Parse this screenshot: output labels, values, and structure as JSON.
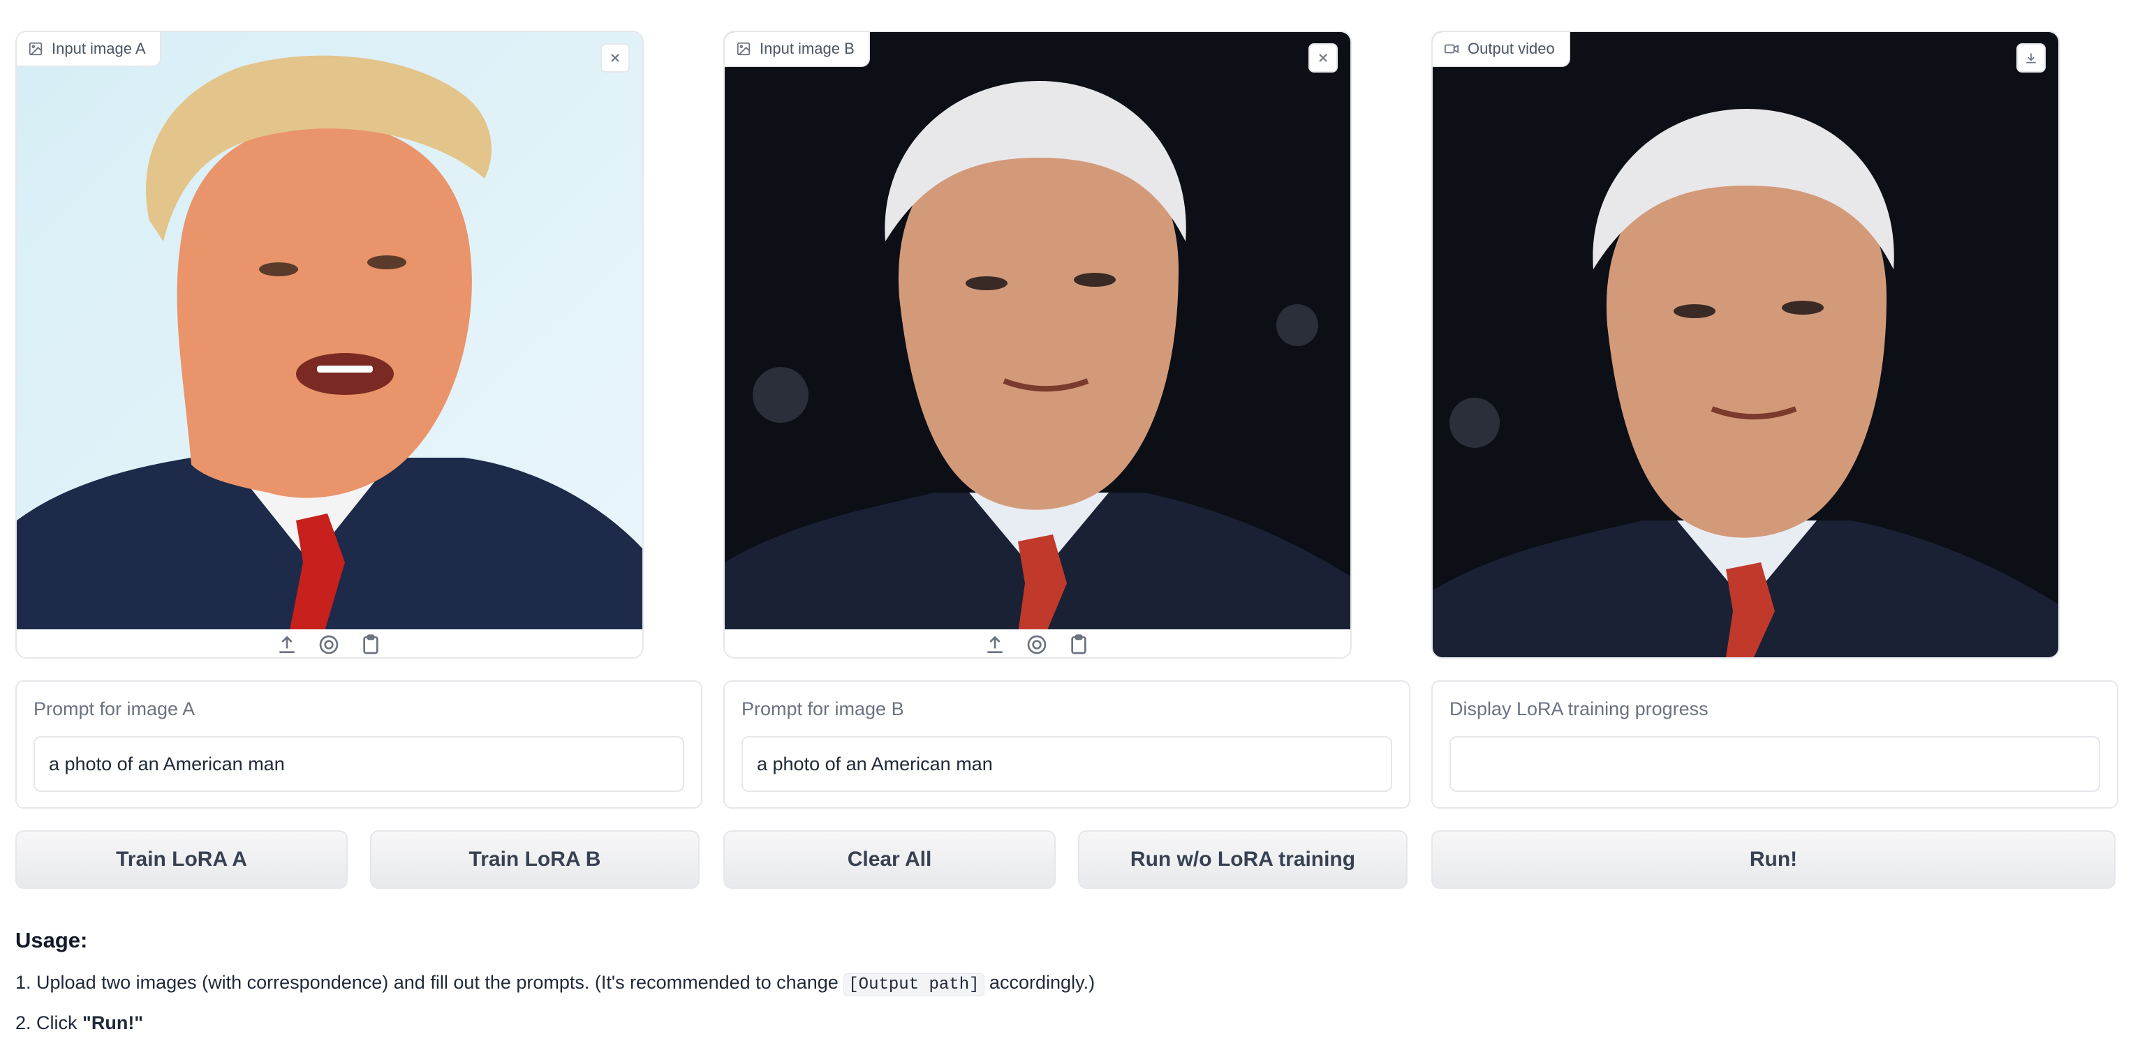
{
  "panels": [
    {
      "label": "Input image A",
      "icon": "image-icon",
      "corner_icon": "close-icon",
      "tools": [
        "upload-icon",
        "webcam-icon",
        "clipboard-icon"
      ]
    },
    {
      "label": "Input image B",
      "icon": "image-icon",
      "corner_icon": "close-icon",
      "tools": [
        "upload-icon",
        "webcam-icon",
        "clipboard-icon"
      ]
    },
    {
      "label": "Output video",
      "icon": "video-icon",
      "corner_icon": "download-icon"
    }
  ],
  "textboxes": [
    {
      "label": "Prompt for image A",
      "value": "a photo of an American man"
    },
    {
      "label": "Prompt for image B",
      "value": "a photo of an American man"
    },
    {
      "label": "Display LoRA training progress",
      "value": ""
    }
  ],
  "buttons": {
    "train_a": "Train LoRA A",
    "train_b": "Train LoRA B",
    "clear_all": "Clear All",
    "run_without": "Run w/o LoRA training",
    "run": "Run!"
  },
  "usage": {
    "title": "Usage:",
    "line1_pre": "1. Upload two images (with correspondence) and fill out the prompts. (It's recommended to change ",
    "line1_code": "[Output path]",
    "line1_post": " accordingly.)",
    "line2_pre": "2. Click ",
    "line2_bold": "\"Run!\""
  }
}
